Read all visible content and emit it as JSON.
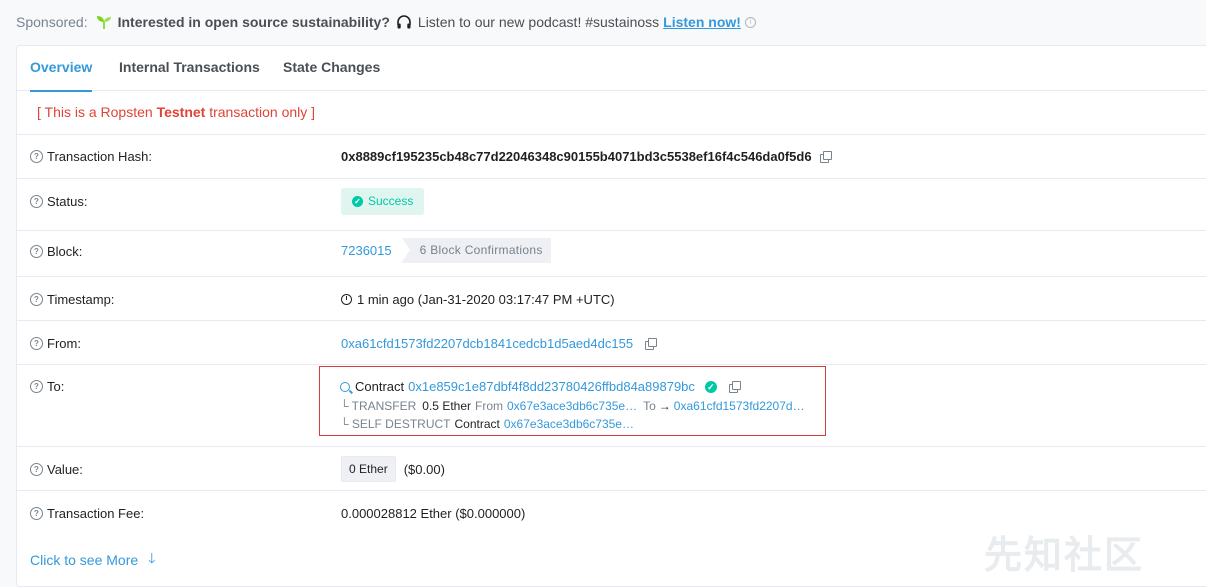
{
  "sponsor": {
    "label": "Sponsored:",
    "bold": "Interested in open source sustainability?",
    "message": "Listen to our new podcast! #sustainoss",
    "link": "Listen now!",
    "info_icon": "i"
  },
  "tabs": [
    "Overview",
    "Internal Transactions",
    "State Changes"
  ],
  "testnet": {
    "prefix": "[ This is a Ropsten ",
    "bold": "Testnet",
    "suffix": " transaction only ]"
  },
  "details": {
    "hash_label": "Transaction Hash:",
    "hash": "0x8889cf195235cb48c77d22046348c90155b4071bd3c5538ef16f4c546da0f5d6",
    "status_label": "Status:",
    "status": "Success",
    "block_label": "Block:",
    "block": "7236015",
    "confirmations": "6 Block Confirmations",
    "timestamp_label": "Timestamp:",
    "timestamp": "1 min ago (Jan-31-2020 03:17:47 PM +UTC)",
    "from_label": "From:",
    "from": "0xa61cfd1573fd2207dcb1841cedcb1d5aed4dc155",
    "to_label": "To:",
    "to_contract_label": "Contract",
    "to_contract": "0x1e859c1e87dbf4f8dd23780426ffbd84a89879bc",
    "transfer": {
      "prefix": "└ TRANSFER",
      "amount": "0.5 Ether",
      "from_label": "From",
      "from": "0x67e3ace3db6c735e…",
      "to_label": "To",
      "to": "0xa61cfd1573fd2207d…"
    },
    "selfdestruct": {
      "prefix": "└ SELF DESTRUCT",
      "label": "Contract",
      "addr": "0x67e3ace3db6c735e…"
    },
    "value_label": "Value:",
    "value": "0 Ether",
    "value_usd": "($0.00)",
    "fee_label": "Transaction Fee:",
    "fee": "0.000028812 Ether ($0.000000)"
  },
  "more": "Click to see More",
  "watermark": "先知社区",
  "colors": {
    "accent": "#3498db",
    "success": "#00c9a7",
    "danger": "#de4437"
  }
}
